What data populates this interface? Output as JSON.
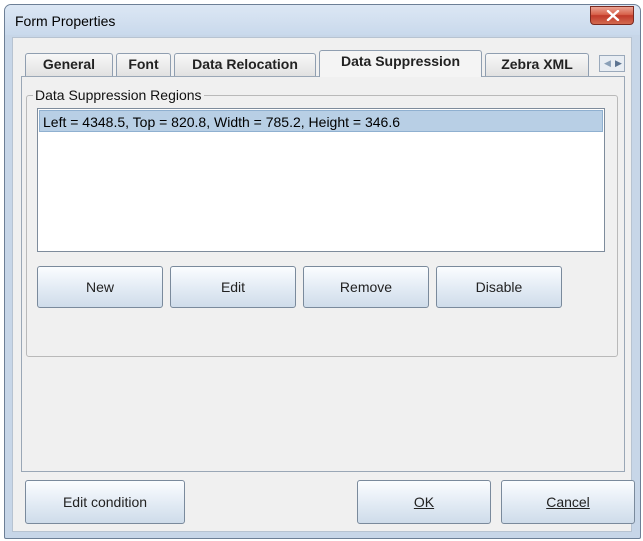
{
  "window": {
    "title": "Form Properties",
    "close_icon": "close-icon"
  },
  "tabs": [
    {
      "label": "General"
    },
    {
      "label": "Font"
    },
    {
      "label": "Data Relocation"
    },
    {
      "label": "Data Suppression",
      "active": true
    },
    {
      "label": "Zebra XML"
    }
  ],
  "group": {
    "label": "Data Suppression Regions",
    "regions": [
      "Left = 4348.5, Top = 820.8, Width = 785.2, Height = 346.6"
    ],
    "buttons": {
      "new": "New",
      "edit": "Edit",
      "remove": "Remove",
      "disable": "Disable"
    }
  },
  "footer": {
    "edit_condition": "Edit condition",
    "ok": "OK",
    "cancel": "Cancel"
  },
  "colors": {
    "selection": "#b8cfe5",
    "frame": "#c7d6e8",
    "close_button": "#c1392a"
  }
}
